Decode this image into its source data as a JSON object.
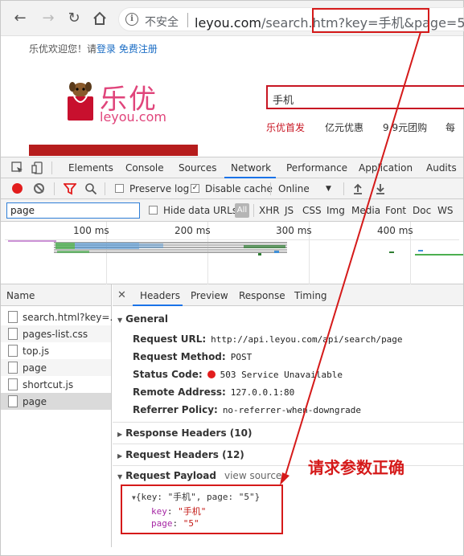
{
  "browser": {
    "security_label": "不安全",
    "url_host": "leyou.com",
    "url_path": "/search.htm",
    "url_query": "?key=手机&page=5"
  },
  "site": {
    "welcome": "乐优欢迎您！请",
    "login": "登录",
    "register": "免费注册",
    "logo_text": "乐优",
    "logo_domain": "leyou.com",
    "search_value": "手机",
    "hot_links": [
      "乐优首发",
      "亿元优惠",
      "9.9元团购",
      "每"
    ]
  },
  "devtools": {
    "tabs": [
      "Elements",
      "Console",
      "Sources",
      "Network",
      "Performance",
      "Application",
      "Audits"
    ],
    "active_tab": "Network",
    "toolbar": {
      "preserve_log": "Preserve log",
      "disable_cache": "Disable cache",
      "throttle": "Online"
    },
    "filter": {
      "value": "page",
      "hide_data_urls": "Hide data URLs",
      "all": "All",
      "types": [
        "XHR",
        "JS",
        "CSS",
        "Img",
        "Media",
        "Font",
        "Doc",
        "WS"
      ]
    },
    "timeline": {
      "ticks": [
        "100 ms",
        "200 ms",
        "300 ms",
        "400 ms"
      ]
    },
    "requests": {
      "header": "Name",
      "items": [
        "search.html?key=...",
        "pages-list.css",
        "top.js",
        "page",
        "shortcut.js",
        "page"
      ]
    },
    "detail": {
      "tabs": [
        "Headers",
        "Preview",
        "Response",
        "Timing"
      ],
      "general_label": "General",
      "general": [
        {
          "key": "Request URL:",
          "value": "http://api.leyou.com/api/search/page"
        },
        {
          "key": "Request Method:",
          "value": "POST"
        },
        {
          "key": "Status Code:",
          "value": "503 Service Unavailable"
        },
        {
          "key": "Remote Address:",
          "value": "127.0.0.1:80"
        },
        {
          "key": "Referrer Policy:",
          "value": "no-referrer-when-downgrade"
        }
      ],
      "response_headers": "Response Headers (10)",
      "request_headers": "Request Headers (12)",
      "request_payload": "Request Payload",
      "view_source": "view source",
      "payload_summary": "{key: \"手机\", page: \"5\"}",
      "payload": [
        {
          "key": "key",
          "value": "\"手机\""
        },
        {
          "key": "page",
          "value": "\"5\""
        }
      ]
    }
  },
  "annotation": "请求参数正确",
  "colors": {
    "annotation_red": "#d51a1a",
    "brand_pink": "#e0457b",
    "devtools_blue": "#1a73e8"
  }
}
